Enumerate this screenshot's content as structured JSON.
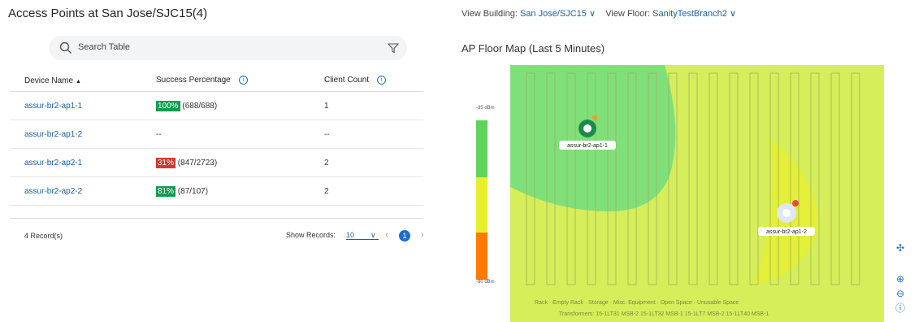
{
  "left": {
    "title": "Access Points at San Jose/SJC15(4)",
    "search_placeholder": "Search Table",
    "columns": [
      "Device Name",
      "Success Percentage",
      "Client Count"
    ],
    "rows": [
      {
        "name": "assur-br2-ap1-1",
        "pct": "100%",
        "detail": "(688/688)",
        "clients": "1",
        "color": "#0f9d4f"
      },
      {
        "name": "assur-br2-ap1-2",
        "pct": "",
        "detail": "--",
        "clients": "--",
        "color": ""
      },
      {
        "name": "assur-br2-ap2-1",
        "pct": "31%",
        "detail": "(847/2723)",
        "clients": "2",
        "color": "#d23a2a"
      },
      {
        "name": "assur-br2-ap2-2",
        "pct": "81%",
        "detail": "(87/107)",
        "clients": "2",
        "color": "#0f9d4f"
      }
    ],
    "records": "4 Record(s)",
    "show_records_label": "Show Records:",
    "show_records_value": "10",
    "current_page": "1"
  },
  "right": {
    "view_building_label": "View Building:",
    "building": "San Jose/SJC15",
    "view_floor_label": "View Floor:",
    "floor": "SanityTestBranch2",
    "map_title": "AP Floor Map (Last 5 Minutes)",
    "legend_top": "-35 dBm",
    "legend_bottom": "-90 dBm",
    "ap_labels": [
      "assur-br2-ap1-1",
      "assur-br2-ap1-2"
    ],
    "legend_items": [
      "Rack",
      "Empty Rack",
      "Storage",
      "Misc. Equipment",
      "Open Space",
      "Unusable Space"
    ],
    "transformers": "Transformers: 15-1LT31 MSB-2  15-1LT32 MSB-1  15-1LT7 MSB-2  15-1LT40 MSB-1",
    "colors": {
      "green": "#5fd35a",
      "yellow": "#e8ef2a",
      "orange": "#ff7a00",
      "heat_green": "#7fe07a",
      "heat_yellow": "#d6ee5a"
    }
  },
  "icons": [
    "search-icon",
    "filter-icon",
    "info-icon",
    "sort-up-icon",
    "chevron-down-icon",
    "chevron-left-icon",
    "chevron-right-icon",
    "zoom-in-icon",
    "zoom-out-icon",
    "reset-view-icon"
  ]
}
